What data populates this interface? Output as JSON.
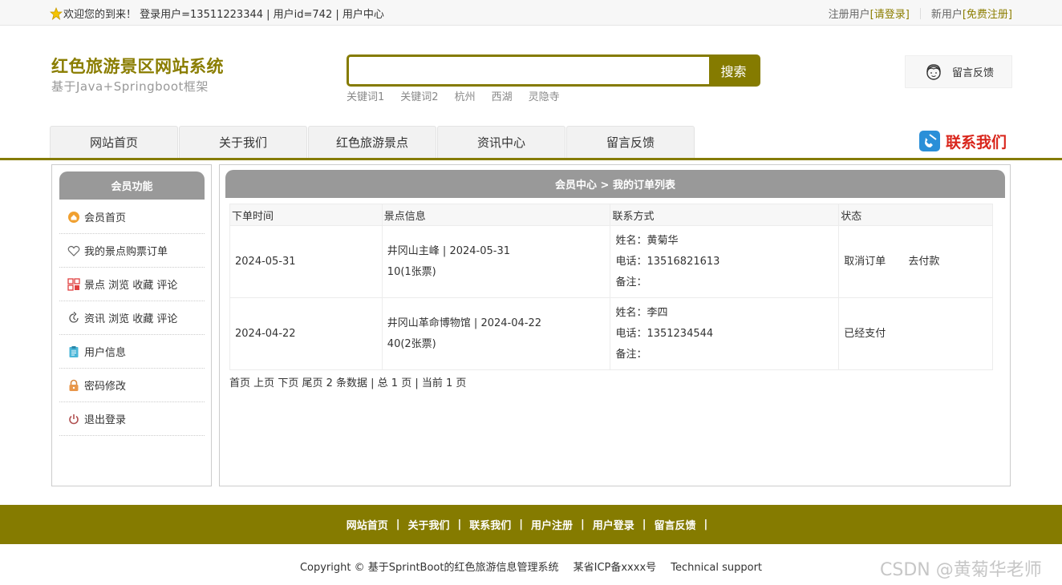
{
  "topbar": {
    "welcome": "欢迎您的到来！ 登录用户=13511223344 | 用户id=742 | 用户中心",
    "register_user": "注册用户",
    "please_login": "[请登录]",
    "new_user": "新用户",
    "free_register": "[免费注册]"
  },
  "header": {
    "title": "红色旅游景区网站系统",
    "subtitle": "基于Java+Springboot框架",
    "search_placeholder": "",
    "search_button": "搜索",
    "keywords": [
      "关键词1",
      "关键词2",
      "杭州",
      "西湖",
      "灵隐寺"
    ],
    "feedback": "留言反馈"
  },
  "nav": {
    "items": [
      "网站首页",
      "关于我们",
      "红色旅游景点",
      "资讯中心",
      "留言反馈"
    ],
    "contact": "联系我们"
  },
  "sidebar": {
    "title": "会员功能",
    "items": [
      {
        "label": "会员首页",
        "icon": "home-icon"
      },
      {
        "label": "我的景点购票订单",
        "icon": "heart-icon"
      },
      {
        "label": "景点 浏览 收藏 评论",
        "icon": "grid-icon"
      },
      {
        "label": "资讯 浏览 收藏 评论",
        "icon": "refresh-icon"
      },
      {
        "label": "用户信息",
        "icon": "clipboard-icon"
      },
      {
        "label": "密码修改",
        "icon": "lock-icon"
      },
      {
        "label": "退出登录",
        "icon": "power-icon"
      }
    ]
  },
  "main": {
    "title": "会员中心 > 我的订单列表",
    "columns": [
      "下单时间",
      "景点信息",
      "联系方式",
      "状态"
    ],
    "orders": [
      {
        "date": "2024-05-31",
        "spot_line1": "井冈山主峰 | 2024-05-31",
        "spot_line2": "10(1张票)",
        "name": "姓名：黄菊华",
        "phone": "电话：13516821613",
        "note": "备注：",
        "action1": "取消订单",
        "action2": "去付款"
      },
      {
        "date": "2024-04-22",
        "spot_line1": "井冈山革命博物馆 | 2024-04-22",
        "spot_line2": "40(2张票)",
        "name": "姓名：李四",
        "phone": "电话：1351234544",
        "note": "备注：",
        "status": "已经支付"
      }
    ],
    "pager": {
      "first": "首页",
      "prev": "上页",
      "next": "下页",
      "last": "尾页",
      "info": "2 条数据 | 总 1 页 | 当前 1 页"
    }
  },
  "footer": {
    "links": [
      "网站首页",
      "关于我们",
      "联系我们",
      "用户注册",
      "用户登录",
      "留言反馈"
    ],
    "copyright": "Copyright © 基于SprintBoot的红色旅游信息管理系统",
    "icp": "某省ICP备xxxx号",
    "support": "Technical support"
  },
  "watermark": "CSDN @黄菊华老师",
  "colors": {
    "brand": "#857b00",
    "accent_red": "#d9261c",
    "header_gray": "#999999"
  }
}
